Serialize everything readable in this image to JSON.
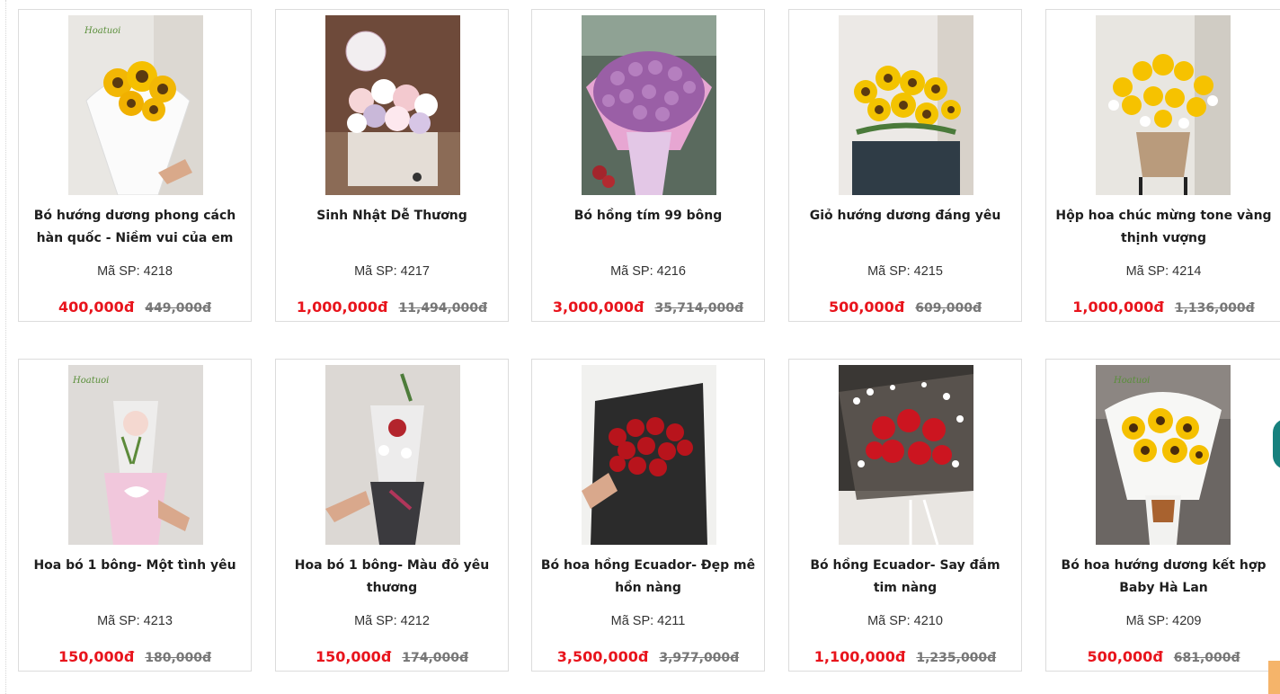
{
  "currency_symbol": "đ",
  "sku_label": "Mã SP:",
  "products": [
    {
      "name": "Bó hướng dương phong cách hàn quốc - Niềm vui của em",
      "sku": "4218",
      "price": "400,000đ",
      "old_price": "449,000đ"
    },
    {
      "name": "Sinh Nhật Dễ Thương",
      "sku": "4217",
      "price": "1,000,000đ",
      "old_price": "11,494,000đ"
    },
    {
      "name": "Bó hồng tím 99 bông",
      "sku": "4216",
      "price": "3,000,000đ",
      "old_price": "35,714,000đ"
    },
    {
      "name": "Giỏ hướng dương đáng yêu",
      "sku": "4215",
      "price": "500,000đ",
      "old_price": "609,000đ"
    },
    {
      "name": "Hộp hoa chúc mừng tone vàng thịnh vượng",
      "sku": "4214",
      "price": "1,000,000đ",
      "old_price": "1,136,000đ"
    },
    {
      "name": "Hoa bó 1 bông- Một tình yêu",
      "sku": "4213",
      "price": "150,000đ",
      "old_price": "180,000đ"
    },
    {
      "name": "Hoa bó 1 bông- Màu đỏ yêu thương",
      "sku": "4212",
      "price": "150,000đ",
      "old_price": "174,000đ"
    },
    {
      "name": "Bó hoa hồng Ecuador- Đẹp mê hồn nàng",
      "sku": "4211",
      "price": "3,500,000đ",
      "old_price": "3,977,000đ"
    },
    {
      "name": "Bó hồng Ecuador- Say đắm tim nàng",
      "sku": "4210",
      "price": "1,100,000đ",
      "old_price": "1,235,000đ"
    },
    {
      "name": "Bó hoa hướng dương kết hợp Baby Hà Lan",
      "sku": "4209",
      "price": "500,000đ",
      "old_price": "681,000đ"
    }
  ]
}
